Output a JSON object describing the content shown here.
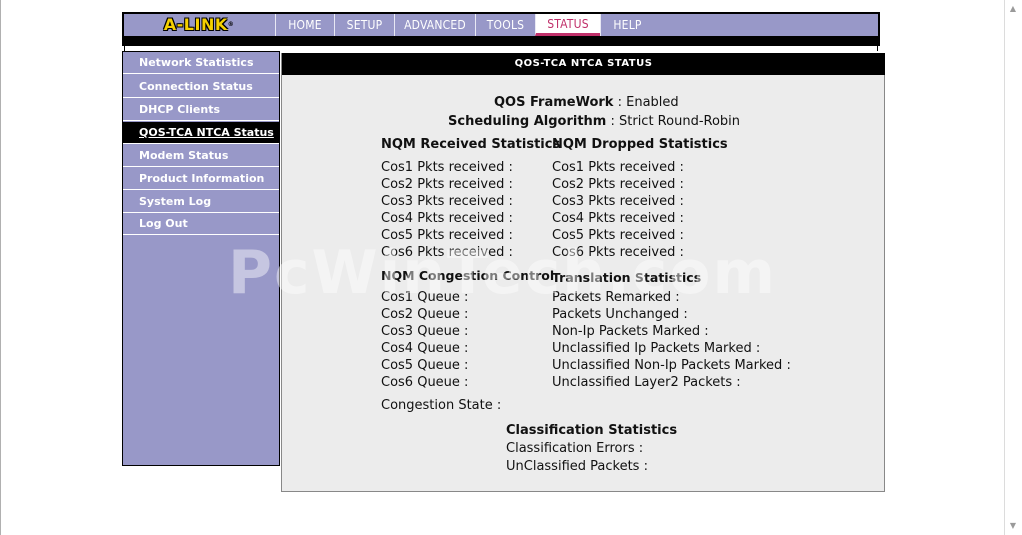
{
  "brand": {
    "logo": "A-LINK",
    "reg": "®"
  },
  "nav": [
    {
      "label": "HOME",
      "width": 59
    },
    {
      "label": "SETUP",
      "width": 60
    },
    {
      "label": "ADVANCED",
      "width": 81
    },
    {
      "label": "TOOLS",
      "width": 60
    },
    {
      "label": "STATUS",
      "width": 65,
      "active": true
    },
    {
      "label": "HELP",
      "width": 54
    }
  ],
  "sidebar": {
    "items": [
      {
        "label": "Network Statistics"
      },
      {
        "label": "Connection Status"
      },
      {
        "label": "DHCP Clients"
      },
      {
        "label": "QOS-TCA NTCA Status",
        "active": true
      },
      {
        "label": "Modem Status"
      },
      {
        "label": "Product Information"
      },
      {
        "label": "System Log"
      },
      {
        "label": "Log Out"
      }
    ]
  },
  "content": {
    "title": "QOS-TCA NTCA STATUS",
    "framework_label": "QOS FrameWork",
    "framework_sep": " : ",
    "framework_value": "Enabled",
    "sched_label": "Scheduling Algorithm",
    "sched_sep": " : ",
    "sched_value": "Strict Round-Robin",
    "nqm_received": {
      "title": "NQM Received Statistics",
      "rows": [
        "Cos1 Pkts received :",
        "Cos2 Pkts received :",
        "Cos3 Pkts received :",
        "Cos4 Pkts received :",
        "Cos5 Pkts received :",
        "Cos6 Pkts received :"
      ]
    },
    "nqm_dropped": {
      "title": "NQM Dropped Statistics",
      "rows": [
        "Cos1 Pkts received :",
        "Cos2 Pkts received :",
        "Cos3 Pkts received :",
        "Cos4 Pkts received :",
        "Cos5 Pkts received :",
        "Cos6 Pkts received :"
      ]
    },
    "congestion": {
      "title": "NQM Congestion Control",
      "rows": [
        "Cos1 Queue :",
        "Cos2 Queue :",
        "Cos3 Queue :",
        "Cos4 Queue :",
        "Cos5 Queue :",
        "Cos6 Queue :"
      ],
      "state": "Congestion State :"
    },
    "translation": {
      "title": "Translation Statistics",
      "rows": [
        "Packets Remarked :",
        "Packets Unchanged :",
        "Non-Ip Packets Marked :",
        "Unclassified Ip Packets Marked :",
        "Unclassified Non-Ip Packets Marked :",
        "Unclassified Layer2 Packets :"
      ]
    },
    "classification": {
      "title": "Classification Statistics",
      "errors": "Classification Errors :",
      "unclassified": "UnClassified Packets :"
    }
  },
  "watermark": "PcWinTech.com",
  "colors": {
    "nav_bg": "#9898c8",
    "active_tab": "#c0306a",
    "logo": "#f5d000",
    "content_bg": "#ececec"
  }
}
